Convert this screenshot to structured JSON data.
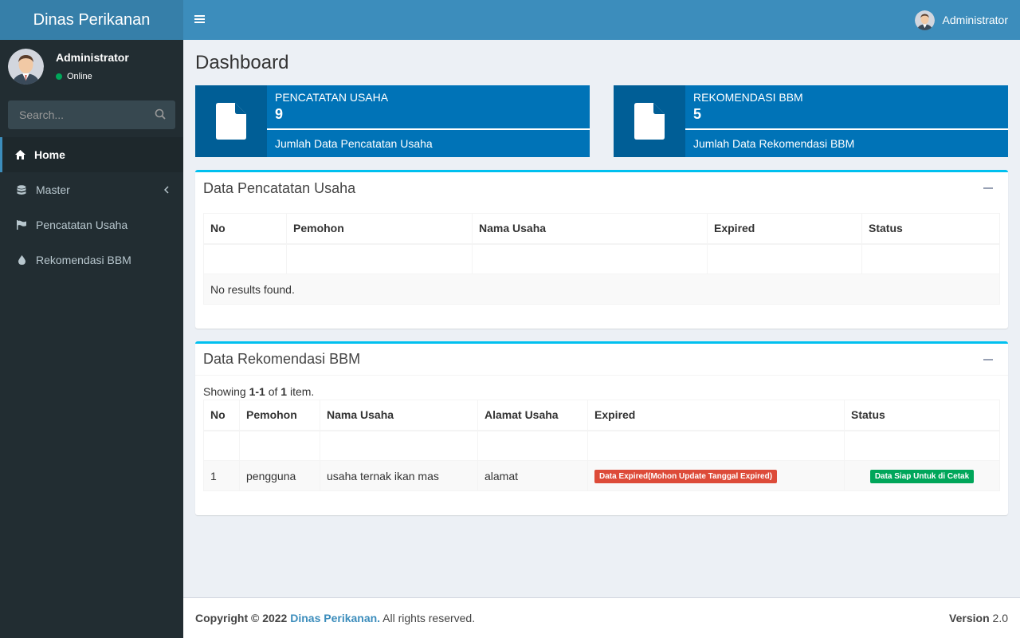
{
  "app": {
    "title": "Dinas Perikanan"
  },
  "user": {
    "name": "Administrator",
    "status": "Online"
  },
  "search": {
    "placeholder": "Search..."
  },
  "menu": [
    {
      "label": "Home",
      "icon": "home-icon"
    },
    {
      "label": "Master",
      "icon": "database-icon"
    },
    {
      "label": "Pencatatan Usaha",
      "icon": "flag-icon"
    },
    {
      "label": "Rekomendasi BBM",
      "icon": "tint-icon"
    }
  ],
  "header": {
    "user_name": "Administrator"
  },
  "page": {
    "title": "Dashboard"
  },
  "info_boxes": [
    {
      "label": "PENCATATAN USAHA",
      "count": "9",
      "description": "Jumlah Data Pencatatan Usaha"
    },
    {
      "label": "REKOMENDASI BBM",
      "count": "5",
      "description": "Jumlah Data Rekomendasi BBM"
    }
  ],
  "pencatatan": {
    "title": "Data Pencatatan Usaha",
    "columns": [
      "No",
      "Pemohon",
      "Nama Usaha",
      "Expired",
      "Status"
    ],
    "empty_text": "No results found."
  },
  "rekomendasi": {
    "title": "Data Rekomendasi BBM",
    "summary_prefix": "Showing ",
    "summary_range": "1-1",
    "summary_of": " of ",
    "summary_total": "1",
    "summary_suffix": " item.",
    "columns": [
      "No",
      "Pemohon",
      "Nama Usaha",
      "Alamat Usaha",
      "Expired",
      "Status"
    ],
    "rows": [
      {
        "no": "1",
        "pemohon": "pengguna",
        "nama_usaha": "usaha ternak ikan mas",
        "alamat": "alamat",
        "expired": "Data Expired(Mohon Update Tanggal Expired)",
        "status": "Data Siap Untuk di Cetak"
      }
    ]
  },
  "footer": {
    "copyright_prefix": "Copyright © 2022 ",
    "org": "Dinas Perikanan.",
    "rights": " All rights reserved.",
    "version_label": "Version",
    "version": " 2.0"
  },
  "colors": {
    "primary": "#3c8dbc",
    "sidebar": "#222d32",
    "info_box": "#0073b7",
    "danger": "#dd4b39",
    "success": "#00a65a"
  }
}
